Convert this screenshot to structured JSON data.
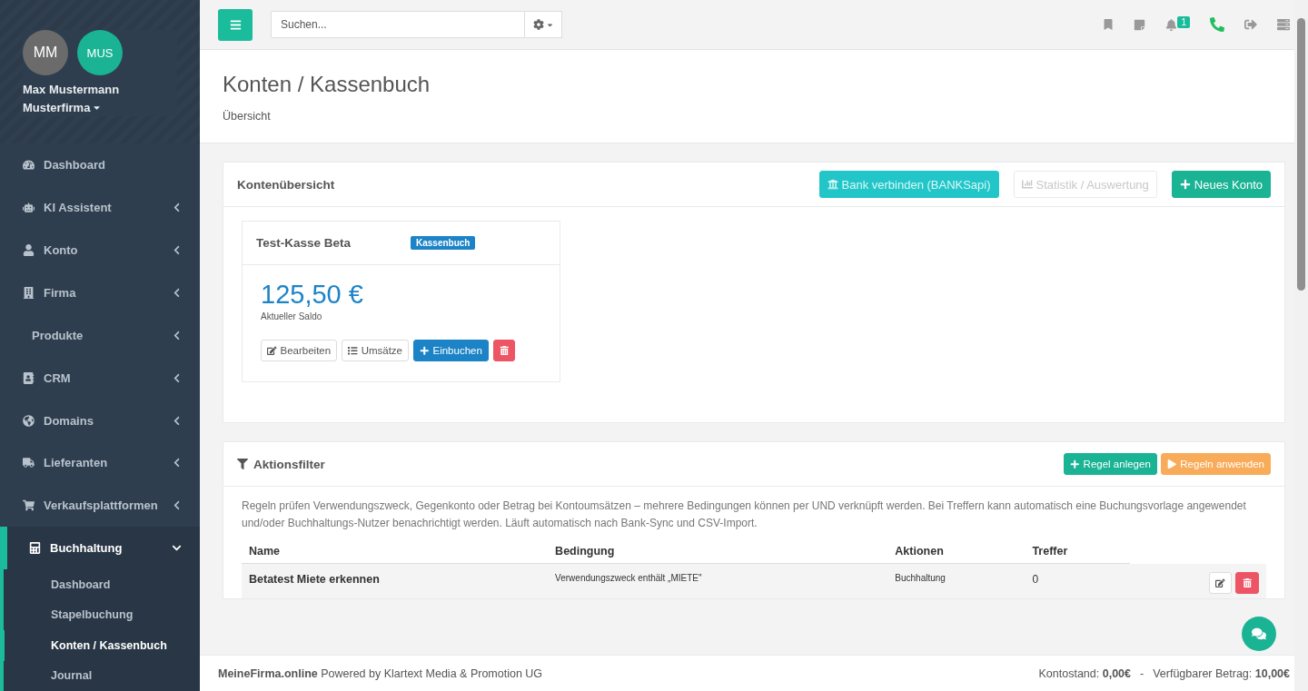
{
  "sidebar": {
    "avatars": [
      "MM",
      "MUS"
    ],
    "user_name": "Max Mustermann",
    "company": "Musterfirma",
    "items": [
      {
        "label": "Dashboard",
        "expandable": false,
        "expanded": false
      },
      {
        "label": "KI Assistent",
        "expandable": true,
        "expanded": false
      },
      {
        "label": "Konto",
        "expandable": true,
        "expanded": false
      },
      {
        "label": "Firma",
        "expandable": true,
        "expanded": false
      },
      {
        "label": "Produkte",
        "expandable": true,
        "expanded": false
      },
      {
        "label": "CRM",
        "expandable": true,
        "expanded": false
      },
      {
        "label": "Domains",
        "expandable": true,
        "expanded": false
      },
      {
        "label": "Lieferanten",
        "expandable": true,
        "expanded": false
      },
      {
        "label": "Verkaufsplattformen",
        "expandable": true,
        "expanded": false
      },
      {
        "label": "Buchhaltung",
        "expandable": true,
        "expanded": true,
        "children": [
          {
            "label": "Dashboard",
            "selected": false
          },
          {
            "label": "Stapelbuchung",
            "selected": false
          },
          {
            "label": "Konten / Kassenbuch",
            "selected": true
          },
          {
            "label": "Journal",
            "selected": false
          }
        ]
      }
    ]
  },
  "topbar": {
    "search": {
      "placeholder": "Suchen..."
    },
    "notification_count": "1"
  },
  "page": {
    "title": "Konten / Kassenbuch",
    "subtitle": "Übersicht"
  },
  "accounts_panel": {
    "title": "Kontenübersicht",
    "buttons": [
      {
        "label": "Bank verbinden (BANKSapi)",
        "kind": "bank",
        "disabled": false
      },
      {
        "label": "Statistik / Auswertung",
        "kind": "stats",
        "disabled": true
      },
      {
        "label": "Neues Konto",
        "kind": "new",
        "disabled": false
      }
    ],
    "accounts": [
      {
        "name": "Test-Kasse Beta",
        "tag": "Kassenbuch",
        "balance": "125,50 €",
        "balance_label": "Aktueller Saldo",
        "actions": [
          {
            "label": "Bearbeiten",
            "kind": "edit"
          },
          {
            "label": "Umsätze",
            "kind": "list"
          },
          {
            "label": "Einbuchen",
            "kind": "book"
          },
          {
            "kind": "delete"
          }
        ]
      }
    ]
  },
  "filter_panel": {
    "title": "Aktionsfilter",
    "buttons": [
      {
        "label": "Regel anlegen",
        "kind": "add"
      },
      {
        "label": "Regeln anwenden",
        "kind": "apply"
      }
    ],
    "description": "Regeln prüfen Verwendungszweck, Gegenkonto oder Betrag bei Kontoumsätzen – mehrere Bedingungen können per UND verknüpft werden. Bei Treffern kann automatisch eine Buchungsvorlage angewendet und/oder Buchhaltungs-Nutzer benachrichtigt werden. Läuft automatisch nach Bank-Sync und CSV-Import.",
    "table": {
      "columns": [
        "Name",
        "Bedingung",
        "Aktionen",
        "Treffer"
      ],
      "rows": [
        {
          "name": "Betatest Miete erkennen",
          "condition": "Verwendungszweck enthält „MIETE\"",
          "actions": "Buchhaltung",
          "hits": "0"
        }
      ]
    }
  },
  "footer": {
    "brand": "**MeineFirma.online** Powered by Klartext Media & Promotion UG",
    "balance": "Kontostand: **0,00€**",
    "separator": "-",
    "available": "Verfügbarer Betrag: **10,00€**"
  }
}
